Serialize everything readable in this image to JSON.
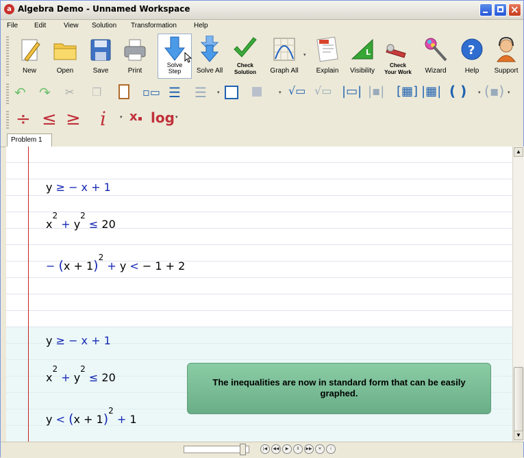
{
  "window": {
    "title": "Algebra Demo - Unnamed Workspace"
  },
  "menu": [
    "File",
    "Edit",
    "View",
    "Solution",
    "Transformation",
    "Help"
  ],
  "toolbar": {
    "new": "New",
    "open": "Open",
    "save": "Save",
    "print": "Print",
    "solve_step_1": "Solve",
    "solve_step_2": "Step",
    "solve_all": "Solve All",
    "check_solution_1": "Check",
    "check_solution_2": "Solution",
    "graph_all": "Graph All",
    "explain": "Explain",
    "visibility": "Visibility",
    "check_work_1": "Check",
    "check_work_2": "Your Work",
    "wizard": "Wizard",
    "help": "Help",
    "support": "Support"
  },
  "math_toolbar": {
    "log": "log",
    "imag": "i",
    "sub_x": "x"
  },
  "tabs": [
    "Problem 1"
  ],
  "problem": {
    "original": {
      "eq1": {
        "lhs": "y",
        "rel": "≥",
        "rhs": "− x + 1"
      },
      "eq2": {
        "a": "x",
        "pow": "2",
        "plus": "+",
        "b": "y",
        "pow2": "2",
        "rel": "≤",
        "rhs": "20"
      },
      "eq3": {
        "neg": "−",
        "inner": "x + 1",
        "pow": "2",
        "plus": "+",
        "y": "y",
        "rel": "<",
        "rhs": "− 1 + 2"
      }
    },
    "result": {
      "eq1": {
        "lhs": "y",
        "rel": "≥",
        "rhs": "− x + 1"
      },
      "eq2": {
        "a": "x",
        "pow": "2",
        "plus": "+",
        "b": "y",
        "pow2": "2",
        "rel": "≤",
        "rhs": "20"
      },
      "eq3": {
        "y": "y",
        "rel": "<",
        "inner": "x + 1",
        "pow": "2",
        "plus": "+",
        "rhs": "1"
      }
    }
  },
  "note": "The inequalities are now in standard form that can be easily graphed.",
  "colors": {
    "operator": "#1428b4",
    "margin": "#c82222",
    "note_bg": "#7fbf98"
  }
}
